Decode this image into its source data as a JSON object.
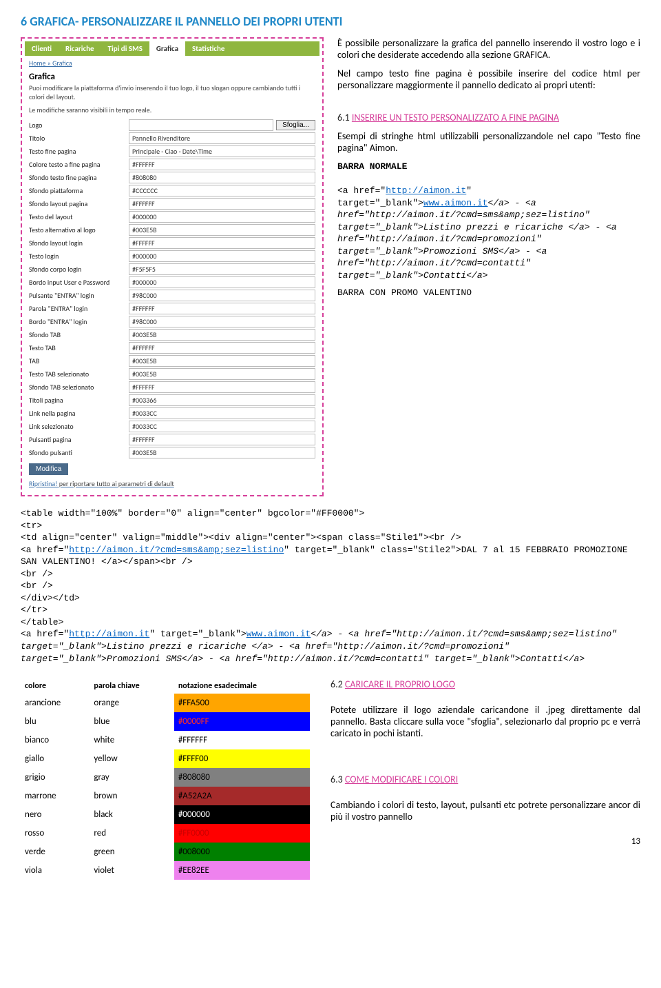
{
  "title": "6   GRAFICA- PERSONALIZZARE IL PANNELLO DEI PROPRI UTENTI",
  "intro_p1": "È possibile personalizzare la grafica del pannello inserendo il vostro logo e i colori che desiderate accedendo alla sezione GRAFICA.",
  "intro_p2": "Nel campo testo fine pagina è possibile inserire del codice html per personalizzare maggiormente il pannello dedicato ai propri utenti:",
  "sub1_num": "6.1 ",
  "sub1_title": "INSERIRE UN TESTO PERSONALIZZATO A FINE PAGINA",
  "sub1_text": "Esempi di stringhe html utilizzabili personalizzandole nel capo \"Testo fine pagina\" Aimon.",
  "barra1_label": "BARRA NORMALE",
  "barra1_code_pre": "<a href=\"",
  "barra1_url1": "http://aimon.it",
  "barra1_code_mid1": "\" target=\"_blank\">",
  "barra1_text1": "www.aimon.it",
  "barra1_code_mid2": "</a> - <a href=\"http://aimon.it/?cmd=sms&amp;sez=listino\" target=\"_blank\">Listino prezzi e ricariche </a> - <a href=\"http://aimon.it/?cmd=promozioni\" target=\"_blank\">Promozioni SMS</a> - <a href=\"http://aimon.it/?cmd=contatti\" target=\"_blank\">Contatti</a>",
  "barra2_label": "BARRA CON PROMO VALENTINO",
  "full_code_l1": "<table width=\"100%\" border=\"0\" align=\"center\" bgcolor=\"#FF0000\">",
  "full_code_l2": "  <tr>",
  "full_code_l3": "    <td align=\"center\" valign=\"middle\"><div align=\"center\"><span class=\"Stile1\"><br />",
  "full_code_l4_pre": "        <a href=\"",
  "full_code_l4_url": "http://aimon.it/?cmd=sms&amp;sez=listino",
  "full_code_l4_post": "\" target=\"_blank\" class=\"Stile2\">DAL 7 al 15 FEBBRAIO PROMOZIONE SAN VALENTINO! </a></span><br />",
  "full_code_l5": "      <br />",
  "full_code_l6": "      <br />",
  "full_code_l7": "    </div></td>",
  "full_code_l8": "  </tr>",
  "full_code_l9": "</table>",
  "full_code_l10_pre": "<a href=\"",
  "full_code_l10_url": "http://aimon.it",
  "full_code_l10_mid": "\" target=\"_blank\">",
  "full_code_l10_text": "www.aimon.it",
  "full_code_l10_post": "</a> - <a href=\"http://aimon.it/?cmd=sms&amp;sez=listino\" target=\"_blank\">Listino prezzi e ricariche </a> - <a href=\"http://aimon.it/?cmd=promozioni\" target=\"_blank\">Promozioni SMS</a> - <a href=\"http://aimon.it/?cmd=contatti\" target=\"_blank\">Contatti</a>",
  "panel": {
    "tabs": [
      "Clienti",
      "Ricariche",
      "Tipi di SMS",
      "Grafica",
      "Statistiche"
    ],
    "breadcrumb": "Home » Grafica",
    "heading": "Grafica",
    "sub1": "Puoi modificare la piattaforma d'invio inserendo il tuo logo, il tuo slogan oppure cambiando tutti i colori del layout.",
    "sub2": "Le modifiche saranno visibili in tempo reale.",
    "sfoglia": "Sfoglia...",
    "modifica": "Modifica",
    "reset_pre": "Ripristina!",
    "reset_post": " per riportare tutto ai parametri di default",
    "rows": [
      {
        "label": "Logo",
        "value": ""
      },
      {
        "label": "Titolo",
        "value": "Pannello Rivenditore"
      },
      {
        "label": "Testo fine pagina",
        "value": "Principale - Ciao - Date\\Time"
      },
      {
        "label": "Colore testo a fine pagina",
        "value": "#FFFFFF"
      },
      {
        "label": "Sfondo testo fine pagina",
        "value": "#808080"
      },
      {
        "label": "Sfondo piattaforma",
        "value": "#CCCCCC"
      },
      {
        "label": "Sfondo layout pagina",
        "value": "#FFFFFF"
      },
      {
        "label": "Testo del layout",
        "value": "#000000"
      },
      {
        "label": "Testo alternativo al logo",
        "value": "#003E5B"
      },
      {
        "label": "Sfondo layout login",
        "value": "#FFFFFF"
      },
      {
        "label": "Testo login",
        "value": "#000000"
      },
      {
        "label": "Sfondo corpo login",
        "value": "#F5F5F5"
      },
      {
        "label": "Bordo input User e Password",
        "value": "#000000"
      },
      {
        "label": "Pulsante \"ENTRA\" login",
        "value": "#98C000"
      },
      {
        "label": "Parola \"ENTRA\" login",
        "value": "#FFFFFF"
      },
      {
        "label": "Bordo \"ENTRA\" login",
        "value": "#98C000"
      },
      {
        "label": "Sfondo TAB",
        "value": "#003E5B"
      },
      {
        "label": "Testo TAB",
        "value": "#FFFFFF"
      },
      {
        "label": "TAB",
        "value": "#003E5B"
      },
      {
        "label": "Testo TAB selezionato",
        "value": "#003E5B"
      },
      {
        "label": "Sfondo TAB selezionato",
        "value": "#FFFFFF"
      },
      {
        "label": "Titoli pagina",
        "value": "#003366"
      },
      {
        "label": "Link nella pagina",
        "value": "#0033CC"
      },
      {
        "label": "Link selezionato",
        "value": "#0033CC"
      },
      {
        "label": "Pulsanti pagina",
        "value": "#FFFFFF"
      },
      {
        "label": "Sfondo pulsanti",
        "value": "#003E5B"
      }
    ]
  },
  "color_table": {
    "headers": [
      "colore",
      "parola chiave",
      "notazione esadecimale"
    ],
    "rows": [
      {
        "c": "arancione",
        "k": "orange",
        "h": "#FFA500",
        "bg": "#FFA500",
        "fg": "#000"
      },
      {
        "c": "blu",
        "k": "blue",
        "h": "#0000FF",
        "bg": "#0000FF",
        "fg": "#ff3020"
      },
      {
        "c": "bianco",
        "k": "white",
        "h": "#FFFFFF",
        "bg": "#FFFFFF",
        "fg": "#000"
      },
      {
        "c": "giallo",
        "k": "yellow",
        "h": "#FFFF00",
        "bg": "#FFFF00",
        "fg": "#000"
      },
      {
        "c": "grigio",
        "k": "gray",
        "h": "#808080",
        "bg": "#808080",
        "fg": "#000"
      },
      {
        "c": "marrone",
        "k": "brown",
        "h": "#A52A2A",
        "bg": "#A52A2A",
        "fg": "#000"
      },
      {
        "c": "nero",
        "k": "black",
        "h": "#000000",
        "bg": "#000000",
        "fg": "#fff"
      },
      {
        "c": "rosso",
        "k": "red",
        "h": "#FF0000",
        "bg": "#FF0000",
        "fg": "#c00"
      },
      {
        "c": "verde",
        "k": "green",
        "h": "#008000",
        "bg": "#008000",
        "fg": "#000"
      },
      {
        "c": "viola",
        "k": "violet",
        "h": "#EE82EE",
        "bg": "#EE82EE",
        "fg": "#000"
      }
    ]
  },
  "sub2_num": "6.2 ",
  "sub2_title": "CARICARE IL PROPRIO LOGO",
  "sub2_text": "Potete utilizzare il logo aziendale caricandone il .jpeg direttamente dal pannello. Basta cliccare sulla voce \"sfoglia\", selezionarlo dal proprio pc e verrà caricato in pochi istanti.",
  "sub3_num": "6.3 ",
  "sub3_title": "COME MODIFICARE I COLORI",
  "sub3_text": "Cambiando i colori di testo, layout, pulsanti etc potrete personalizzare ancor di più il vostro pannello",
  "page_num": "13"
}
